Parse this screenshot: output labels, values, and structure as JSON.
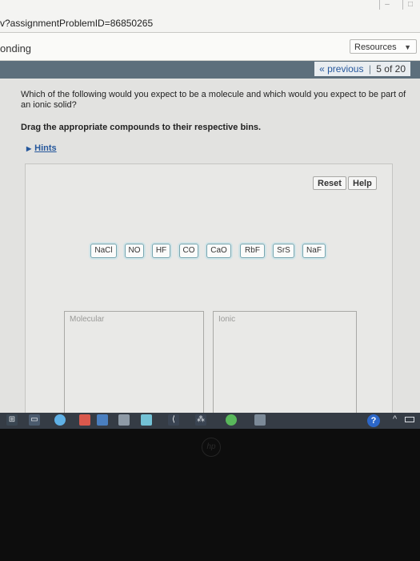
{
  "browser": {
    "url_fragment": "v?assignmentProblemID=86850265"
  },
  "header": {
    "course_title": "onding",
    "resources_label": "Resources",
    "resources_caret": "▼"
  },
  "nav": {
    "previous_label": "« previous",
    "separator": "|",
    "page_indicator": "5 of 20",
    "trailing_separator": "|"
  },
  "problem": {
    "question": "Which of the following would you expect to be a molecule and which would you expect to be part of an ionic solid?",
    "instruction": "Drag the appropriate compounds to their respective bins.",
    "hints_label": "Hints"
  },
  "toolbar": {
    "reset_label": "Reset",
    "help_label": "Help"
  },
  "compounds": [
    "NaCl",
    "NO",
    "HF",
    "CO",
    "CaO",
    "RbF",
    "SrS",
    "NaF"
  ],
  "bins": {
    "molecular_label": "Molecular",
    "ionic_label": "Ionic"
  },
  "taskbar": {
    "help_glyph": "?",
    "up_glyph": "^"
  },
  "device": {
    "logo": "hp"
  },
  "colors": {
    "link_blue": "#25579c",
    "nav_bar": "#5d6f7c",
    "chip_border": "#77a6b0",
    "taskbar": "#353c45"
  }
}
